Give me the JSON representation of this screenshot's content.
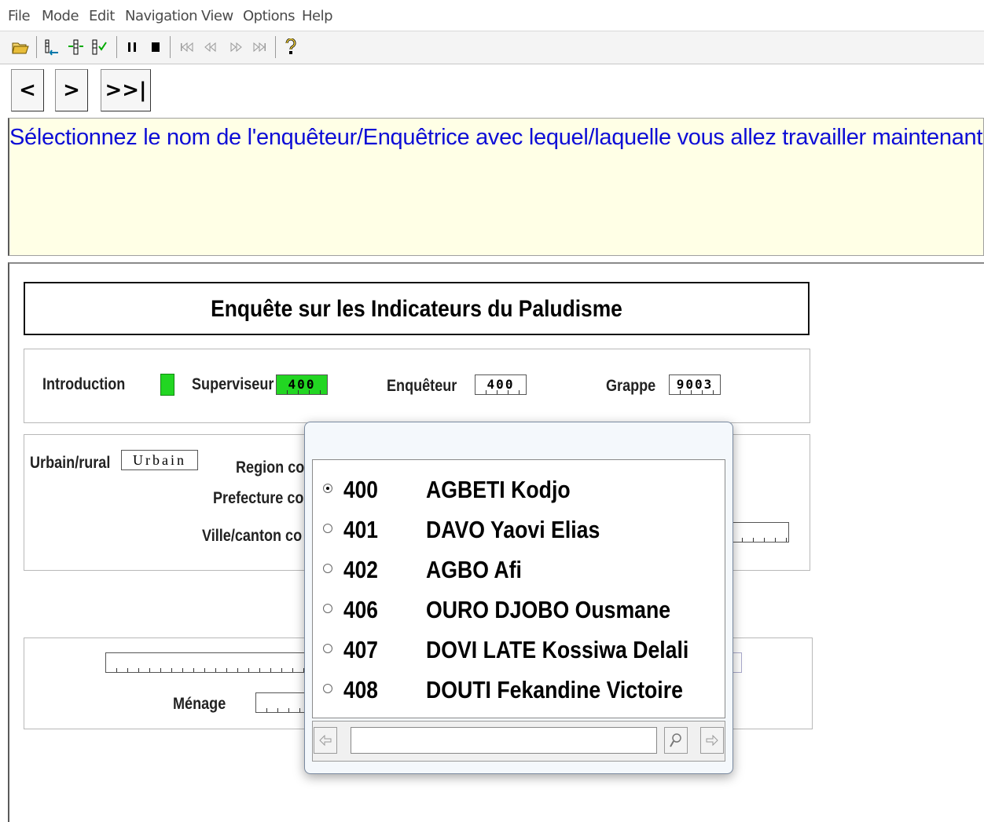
{
  "menubar": {
    "items": [
      "File",
      "Mode",
      "Edit",
      "Navigation",
      "View",
      "Options",
      "Help"
    ]
  },
  "toolbar": {
    "icons": [
      "open-folder-icon",
      "add-case-icon",
      "insert-case-icon",
      "verify-case-icon",
      "pause-icon",
      "stop-icon",
      "first-icon",
      "previous-icon",
      "next-icon",
      "last-icon",
      "help-icon"
    ]
  },
  "nav": {
    "prev_label": "<",
    "next_label": ">",
    "end_label": ">>|"
  },
  "question": {
    "text": "Sélectionnez le nom de l'enquêteur/Enquêtrice avec lequel/laquelle vous allez travailler maintenant",
    "color": "#0d0dd6"
  },
  "form": {
    "title": "Enquête sur les Indicateurs du Paludisme",
    "labels": {
      "introduction": "Introduction",
      "superviseur": "Superviseur",
      "enqueteur": "Enquêteur",
      "grappe": "Grappe",
      "urbain_rural": "Urbain/rural",
      "region": "Region co",
      "prefecture": "Prefecture co",
      "ville_canton": "Ville/canton co",
      "menage": "Ménage"
    },
    "values": {
      "superviseur": "400",
      "enqueteur": "400",
      "grappe": "9003",
      "urbain_rural": "Urbain"
    },
    "colors": {
      "active_field": "#22d622"
    }
  },
  "popup": {
    "options": [
      {
        "code": "400",
        "name": "AGBETI Kodjo",
        "selected": true
      },
      {
        "code": "401",
        "name": "DAVO Yaovi Elias",
        "selected": false
      },
      {
        "code": "402",
        "name": "AGBO Afi",
        "selected": false
      },
      {
        "code": "406",
        "name": "OURO DJOBO Ousmane",
        "selected": false
      },
      {
        "code": "407",
        "name": "DOVI LATE Kossiwa Delali",
        "selected": false
      },
      {
        "code": "408",
        "name": "DOUTI Fekandine Victoire",
        "selected": false
      }
    ],
    "search_value": ""
  }
}
